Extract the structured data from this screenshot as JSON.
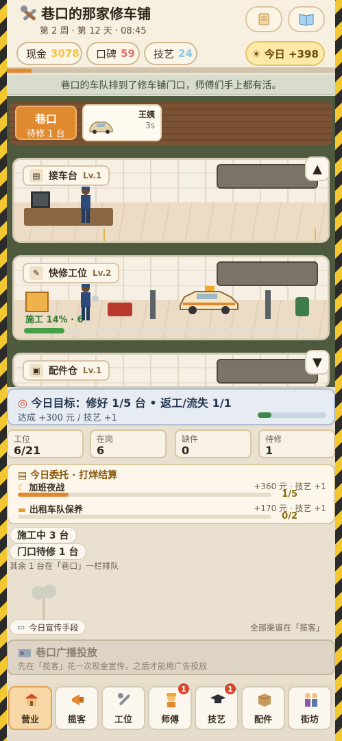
{
  "header": {
    "title": "巷口的那家修车铺",
    "subtitle": "第 2 周 · 第 12 天 · 08:45",
    "stats": [
      {
        "label": "现金",
        "value": "3078",
        "color": "#f2c14a"
      },
      {
        "label": "口碑",
        "value": "59",
        "color": "#e0726a"
      },
      {
        "label": "技艺",
        "value": "24",
        "color": "#8cc6e8"
      }
    ],
    "today": "☀ 今日 +398"
  },
  "notice": "巷口的车队排到了修车铺门口，师傅们手上都有活。",
  "lane": {
    "title": "巷口",
    "pending": "待修 1 台",
    "queue_customer": "王姨",
    "queue_time": "3s"
  },
  "rooms": [
    {
      "name": "接车台",
      "level": "Lv.1"
    },
    {
      "name": "快修工位",
      "level": "Lv.2",
      "status": "施工 14% · 6",
      "progress": 0.14
    },
    {
      "name": "配件仓",
      "level": "Lv.1"
    }
  ],
  "goal": {
    "title": "今日目标：修好 1/5 台 • 返工/流失 1/1",
    "reward": "达成 +300 元 / 技艺 +1",
    "progress": 0.2
  },
  "stat_cards": [
    {
      "label": "工位",
      "value": "6/21"
    },
    {
      "label": "在岗",
      "value": "6"
    },
    {
      "label": "缺件",
      "value": "0"
    },
    {
      "label": "待修",
      "value": "1"
    }
  ],
  "orders": {
    "title": "今日委托 · 打烊结算",
    "items": [
      {
        "name": "加班夜战",
        "reward": "+360 元 · 技艺 +1",
        "count": "1/5",
        "progress": 0.2
      },
      {
        "name": "出租车队保养",
        "reward": "+170 元 · 技艺 +1",
        "count": "0/2",
        "progress": 0.0
      }
    ]
  },
  "status": {
    "working": "施工中 3 台",
    "waiting": "门口待修 1 台",
    "note": "其余 1 台在「巷口」一栏排队"
  },
  "promo": {
    "link": "今日宣传手段",
    "right": "全部渠道在「揽客」"
  },
  "broadcast": {
    "title": "巷口广播投放",
    "desc": "先在「揽客」花一次现金宣传，之后才能用广告投放"
  },
  "nav": [
    {
      "label": "营业",
      "icon": "shop-icon",
      "active": true
    },
    {
      "label": "揽客",
      "icon": "megaphone-icon"
    },
    {
      "label": "工位",
      "icon": "wrench-icon"
    },
    {
      "label": "师傅",
      "icon": "worker-icon",
      "badge": "1"
    },
    {
      "label": "技艺",
      "icon": "graduation-cap-icon",
      "badge": "1"
    },
    {
      "label": "配件",
      "icon": "box-icon"
    },
    {
      "label": "街坊",
      "icon": "neighbors-icon"
    }
  ]
}
